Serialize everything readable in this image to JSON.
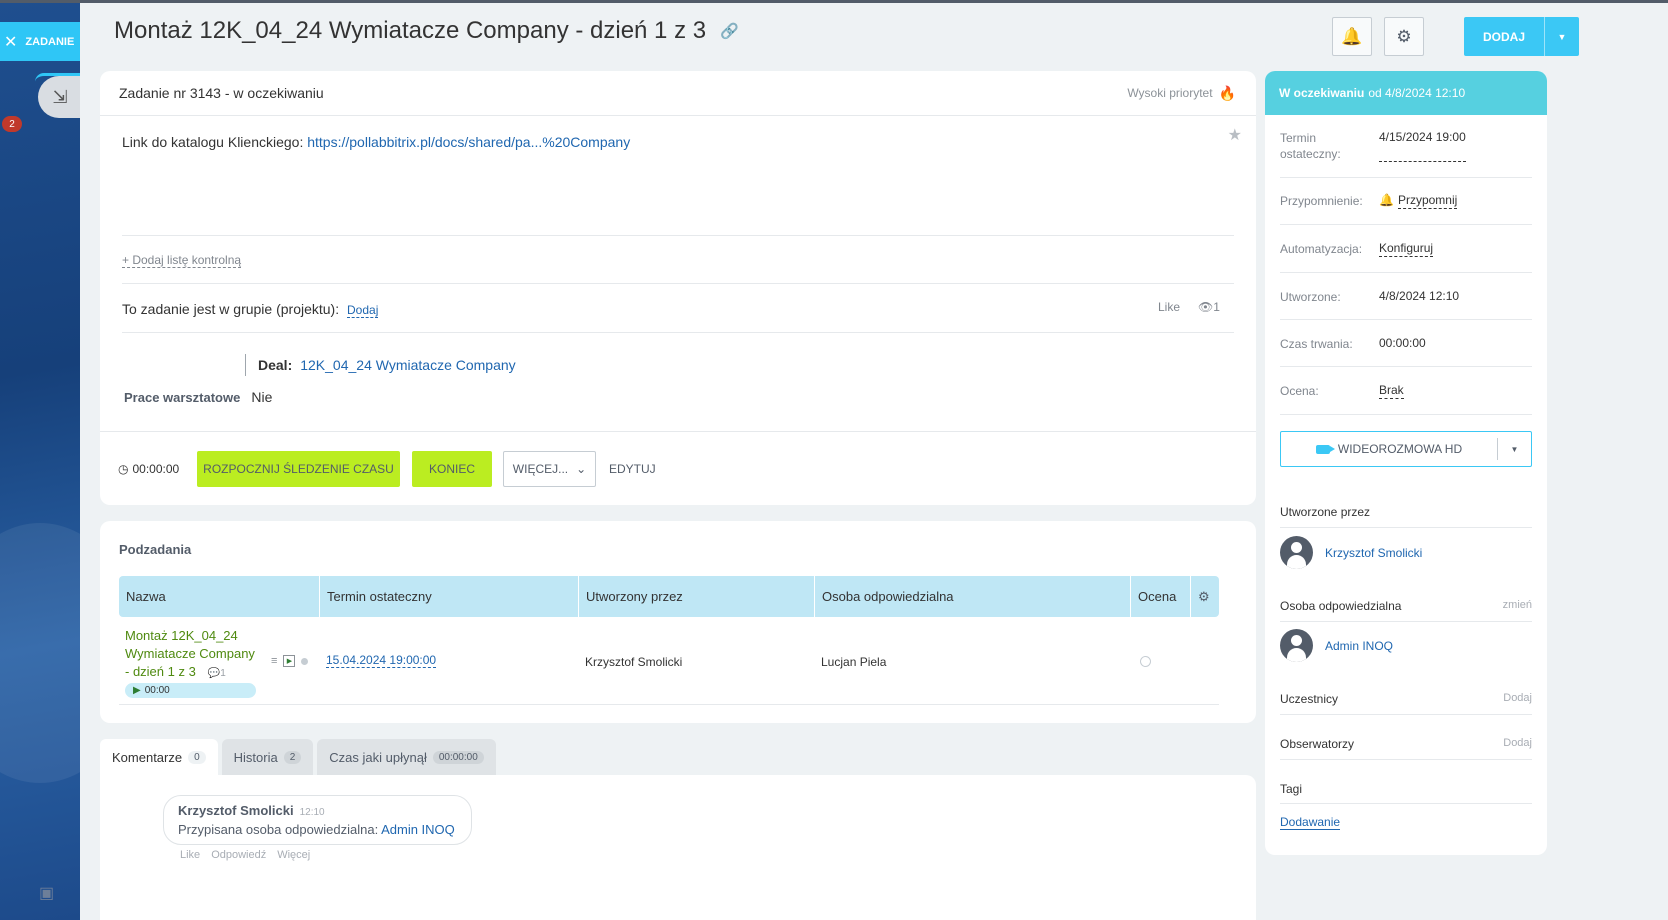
{
  "left": {
    "tab_label": "ZADANIE",
    "notification_count": "2"
  },
  "header": {
    "title": "Montaż 12K_04_24 Wymiatacze Company - dzień 1 z 3",
    "add_label": "DODAJ"
  },
  "task": {
    "head": "Zadanie nr 3143 - w oczekiwaniu",
    "priority": "Wysoki priorytet",
    "desc_label": "Link do katalogu Klienckiego:",
    "desc_link": "https://pollabbitrix.pl/docs/shared/pa...%20Company",
    "checklist": "+ Dodaj listę kontrolną",
    "group_label": "To zadanie jest w grupie (projektu):",
    "group_add": "Dodaj",
    "like": "Like",
    "views": "1",
    "deal_label": "Deal:",
    "deal_value": "12K_04_24 Wymiatacze Company",
    "prace_label": "Prace warsztatowe",
    "prace_value": "Nie",
    "timer": "00:00:00",
    "btn_start": "ROZPOCZNIJ ŚLEDZENIE CZASU",
    "btn_end": "KONIEC",
    "btn_more": "WIĘCEJ...",
    "btn_edit": "EDYTUJ"
  },
  "subtasks": {
    "title": "Podzadania",
    "columns": [
      "Nazwa",
      "Termin ostateczny",
      "Utworzony przez",
      "Osoba odpowiedzialna",
      "Ocena"
    ],
    "rows": [
      {
        "name": "Montaż 12K_04_24 Wymiatacze Company - dzień 1 z 3",
        "comments": "1",
        "timer": "00:00",
        "deadline": "15.04.2024  19:00:00",
        "creator": "Krzysztof Smolicki",
        "responsible": "Lucjan Piela"
      }
    ]
  },
  "tabs": [
    {
      "label": "Komentarze",
      "count": "0"
    },
    {
      "label": "Historia",
      "count": "2"
    },
    {
      "label": "Czas jaki upłynął",
      "count": "00:00:00"
    }
  ],
  "comment": {
    "author": "Krzysztof Smolicki",
    "time": "12:10",
    "text": "Przypisana osoba odpowiedzialna:",
    "link": "Admin INOQ",
    "actions": [
      "Like",
      "Odpowiedź",
      "Więcej"
    ]
  },
  "sidebar": {
    "status_bold": "W oczekiwaniu",
    "status_rest": "od 4/8/2024 12:10",
    "props": [
      {
        "key": "Termin ostateczny:",
        "value": "4/15/2024 19:00"
      },
      {
        "key": "Przypomnienie:",
        "value": "Przypomnij"
      },
      {
        "key": "Automatyzacja:",
        "value": "Konfiguruj"
      },
      {
        "key": "Utworzone:",
        "value": "4/8/2024 12:10"
      },
      {
        "key": "Czas trwania:",
        "value": "00:00:00"
      },
      {
        "key": "Ocena:",
        "value": "Brak"
      }
    ],
    "video_label": "WIDEOROZMOWA HD",
    "created_by_title": "Utworzone przez",
    "created_by": "Krzysztof Smolicki",
    "responsible_title": "Osoba odpowiedzialna",
    "responsible_change": "zmień",
    "responsible": "Admin INOQ",
    "participants_title": "Uczestnicy",
    "observers_title": "Obserwatorzy",
    "add_label": "Dodaj",
    "tags_title": "Tagi",
    "tags_add": "Dodawanie"
  },
  "colors": {
    "accent": "#3bc8f5",
    "green_button": "#bbed21",
    "status": "#56d0e0",
    "link": "#2067b0"
  }
}
